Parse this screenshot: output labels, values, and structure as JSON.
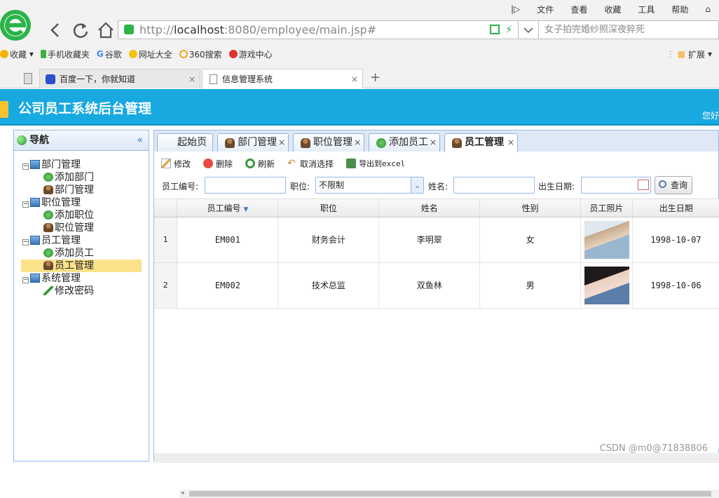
{
  "browser": {
    "menu": [
      "文件",
      "查看",
      "收藏",
      "工具",
      "帮助"
    ],
    "url_prefix": "http://",
    "url_host": "localhost",
    "url_rest": ":8080/employee/main.jsp#",
    "search_placeholder": "女子拍完婚纱照深夜猝死",
    "bookmarks": [
      "收藏",
      "手机收藏夹",
      "谷歌",
      "网址大全",
      "360搜索",
      "游戏中心"
    ],
    "extensions_label": "扩展",
    "tabs": [
      {
        "label": "百度一下，你就知道",
        "active": false
      },
      {
        "label": "信息管理系统",
        "active": true
      }
    ],
    "new_tab": "+"
  },
  "header": {
    "title": "公司员工系统后台管理",
    "welcome": "您好"
  },
  "nav": {
    "title": "导航",
    "collapse": "«",
    "tree": [
      {
        "label": "部门管理",
        "level": 0,
        "icon": "computer-icon"
      },
      {
        "label": "添加部门",
        "level": 1,
        "icon": "add-icon"
      },
      {
        "label": "部门管理",
        "level": 1,
        "icon": "user-icon"
      },
      {
        "label": "职位管理",
        "level": 0,
        "icon": "computer-icon"
      },
      {
        "label": "添加职位",
        "level": 1,
        "icon": "add-icon"
      },
      {
        "label": "职位管理",
        "level": 1,
        "icon": "user-icon"
      },
      {
        "label": "员工管理",
        "level": 0,
        "icon": "computer-icon"
      },
      {
        "label": "添加员工",
        "level": 1,
        "icon": "add-icon"
      },
      {
        "label": "员工管理",
        "level": 1,
        "icon": "user-icon",
        "selected": true
      },
      {
        "label": "系统管理",
        "level": 0,
        "icon": "computer-icon"
      },
      {
        "label": "修改密码",
        "level": 1,
        "icon": "pencil-icon"
      }
    ]
  },
  "tabs": [
    {
      "label": "起始页",
      "closable": false
    },
    {
      "label": "部门管理",
      "closable": true,
      "icon": "user-icon"
    },
    {
      "label": "职位管理",
      "closable": true,
      "icon": "user-icon"
    },
    {
      "label": "添加员工",
      "closable": true,
      "icon": "add-icon"
    },
    {
      "label": "员工管理",
      "closable": true,
      "icon": "user-icon",
      "active": true
    }
  ],
  "toolbar": {
    "edit": "修改",
    "delete": "删除",
    "refresh": "刷新",
    "cancel_select": "取消选择",
    "export": "导出到excel"
  },
  "filters": {
    "emp_no_label": "员工编号:",
    "position_label": "职位:",
    "position_value": "不限制",
    "name_label": "姓名:",
    "birth_label": "出生日期:",
    "query": "查询"
  },
  "grid": {
    "columns": [
      "员工编号",
      "职位",
      "姓名",
      "性别",
      "员工照片",
      "出生日期"
    ],
    "rows": [
      {
        "num": "1",
        "emp_no": "EM001",
        "position": "财务会计",
        "name": "李明翠",
        "gender": "女",
        "birth": "1998-10-07"
      },
      {
        "num": "2",
        "emp_no": "EM002",
        "position": "技术总监",
        "name": "双鱼林",
        "gender": "男",
        "birth": "1998-10-06"
      }
    ]
  },
  "watermark": "CSDN @m0@71838806"
}
